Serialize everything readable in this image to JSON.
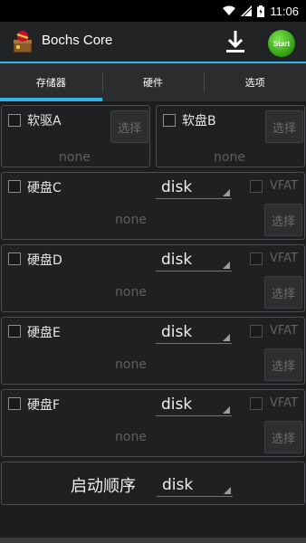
{
  "status": {
    "time": "11:06"
  },
  "app": {
    "title": "Bochs Core",
    "start_label": "Start"
  },
  "tabs": [
    {
      "label": "存储器",
      "active": true
    },
    {
      "label": "硬件",
      "active": false
    },
    {
      "label": "选项",
      "active": false
    }
  ],
  "floppies": [
    {
      "label": "软驱A",
      "value": "none",
      "select_label": "选择"
    },
    {
      "label": "软盘B",
      "value": "none",
      "select_label": "选择"
    }
  ],
  "disks": [
    {
      "label": "硬盘C",
      "type": "disk",
      "vfat_label": "VFAT",
      "value": "none",
      "select_label": "选择"
    },
    {
      "label": "硬盘D",
      "type": "disk",
      "vfat_label": "VFAT",
      "value": "none",
      "select_label": "选择"
    },
    {
      "label": "硬盘E",
      "type": "disk",
      "vfat_label": "VFAT",
      "value": "none",
      "select_label": "选择"
    },
    {
      "label": "硬盘F",
      "type": "disk",
      "vfat_label": "VFAT",
      "value": "none",
      "select_label": "选择"
    }
  ],
  "boot": {
    "label": "启动顺序",
    "value": "disk"
  },
  "colors": {
    "accent": "#33b5e5",
    "start_green": "#3fae1f"
  }
}
